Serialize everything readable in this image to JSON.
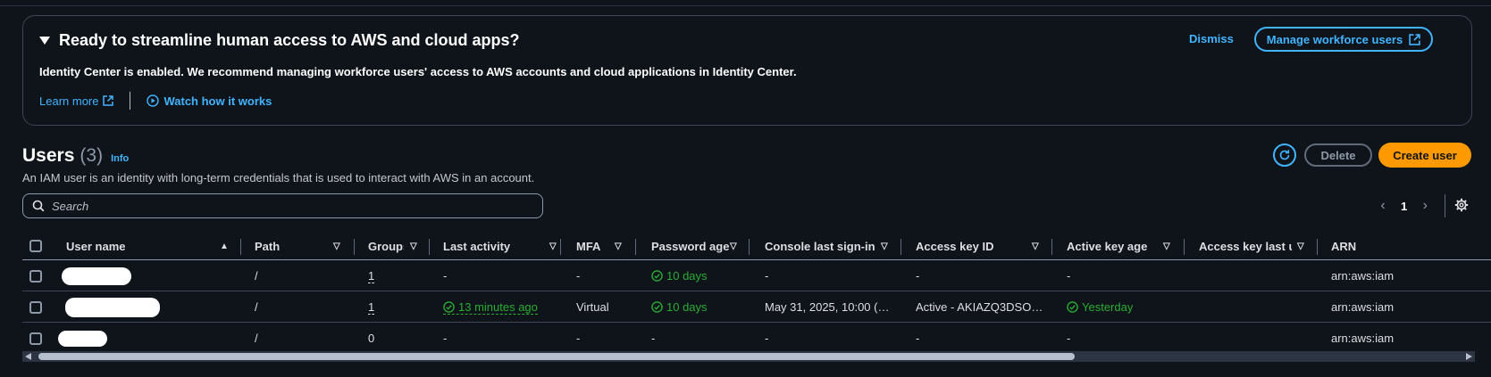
{
  "banner": {
    "title": "Ready to streamline human access to AWS and cloud apps?",
    "description": "Identity Center is enabled. We recommend managing workforce users' access to AWS accounts and cloud applications in Identity Center.",
    "learn_more": "Learn more",
    "watch": "Watch how it works",
    "dismiss": "Dismiss",
    "manage": "Manage workforce users"
  },
  "users": {
    "title": "Users",
    "count": "(3)",
    "info": "Info",
    "description": "An IAM user is an identity with long-term credentials that is used to interact with AWS in an account.",
    "delete": "Delete",
    "create": "Create user"
  },
  "search": {
    "placeholder": "Search"
  },
  "pager": {
    "page": "1"
  },
  "table": {
    "headers": {
      "user_name": "User name",
      "path": "Path",
      "groups": "Groups",
      "last_activity": "Last activity",
      "mfa": "MFA",
      "password_age": "Password age",
      "console": "Console last sign-in",
      "access_key": "Access key ID",
      "active_key_age": "Active key age",
      "access_key_last_used": "Access key last used",
      "arn": "ARN"
    },
    "rows": [
      {
        "path": "/",
        "groups": "1",
        "last_activity": "-",
        "mfa": "-",
        "password_age": "10 days",
        "console": "-",
        "access_key": "-",
        "active_key_age": "-",
        "access_key_last_used": "",
        "arn": "arn:aws:iam"
      },
      {
        "path": "/",
        "groups": "1",
        "last_activity": "13 minutes ago",
        "mfa": "Virtual",
        "password_age": "10 days",
        "console": "May 31, 2025, 10:00 (…",
        "access_key": "Active - AKIAZQ3DSO…",
        "active_key_age": "Yesterday",
        "access_key_last_used": "",
        "arn": "arn:aws:iam"
      },
      {
        "path": "/",
        "groups": "0",
        "last_activity": "-",
        "mfa": "-",
        "password_age": "-",
        "console": "-",
        "access_key": "-",
        "active_key_age": "-",
        "access_key_last_used": "",
        "arn": "arn:aws:iam"
      }
    ]
  },
  "colors": {
    "background": "#0f141a",
    "link": "#42b4ff",
    "primary": "#ff9900",
    "success": "#29ad32"
  }
}
